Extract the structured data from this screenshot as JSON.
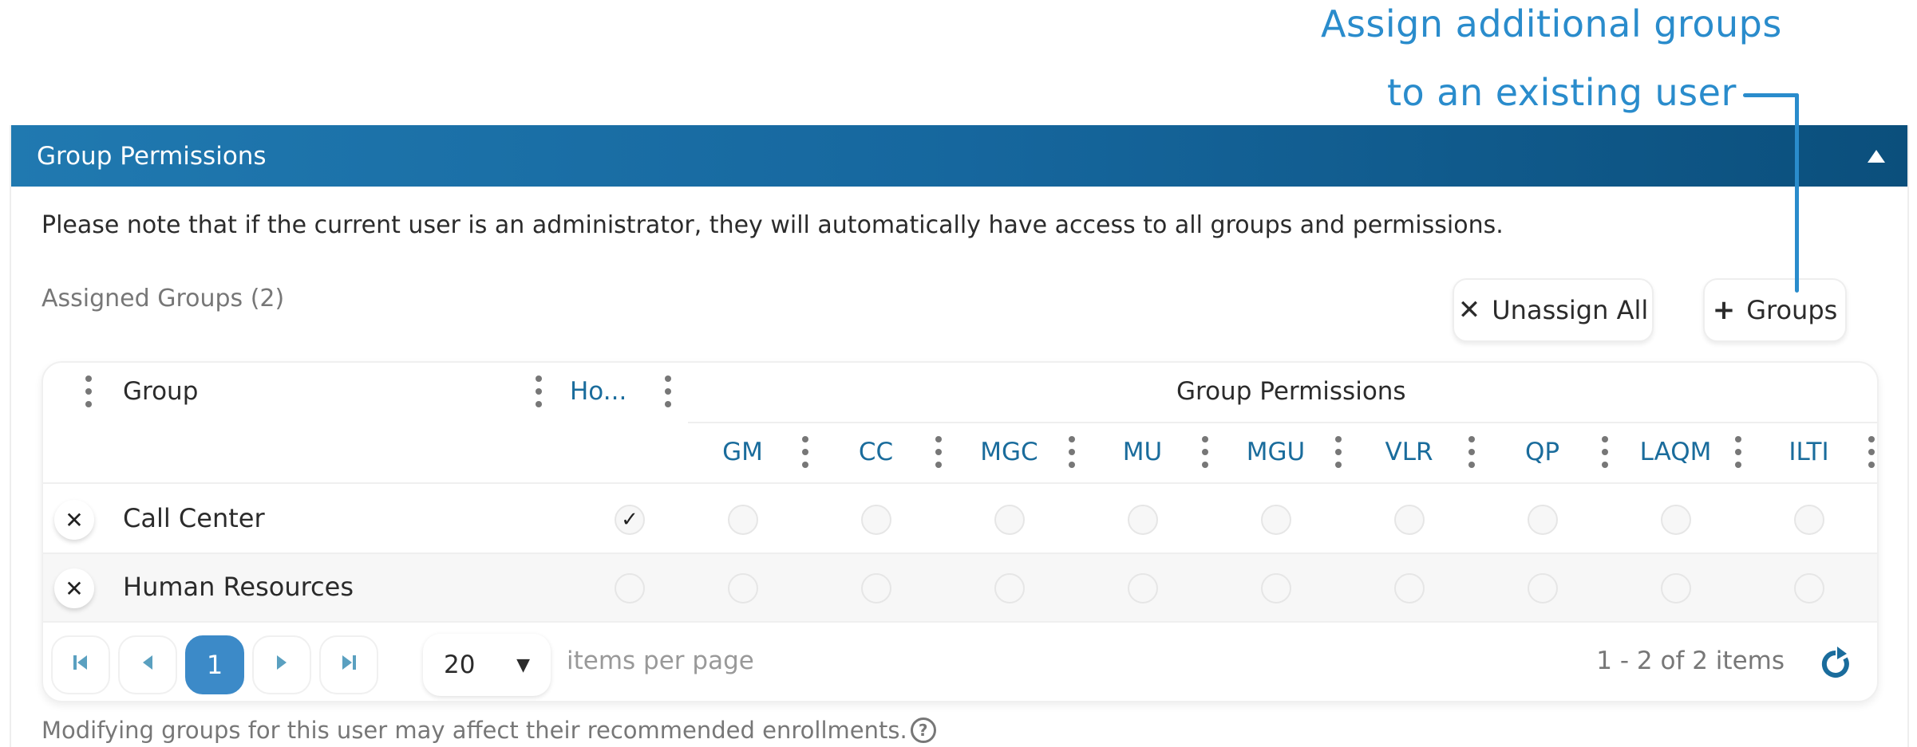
{
  "callout": {
    "line1": "Assign additional groups",
    "line2": "to an existing user",
    "color": "#2a8ccc"
  },
  "panel": {
    "title": "Group Permissions",
    "collapse_icon": "triangle-up-icon",
    "note": "Please note that if the current user is an administrator, they will automatically have access to all groups and permissions.",
    "assigned_label": "Assigned Groups (2)",
    "header_color": "#1a6ea4"
  },
  "toolbar": {
    "unassign_icon": "✕",
    "unassign_label": "Unassign All",
    "add_icon": "+",
    "add_label": "Groups"
  },
  "grid": {
    "columns": {
      "group": "Group",
      "home": "Ho...",
      "permissions_group": "Group Permissions",
      "permissions": [
        "GM",
        "CC",
        "MGC",
        "MU",
        "MGU",
        "VLR",
        "QP",
        "LAQM",
        "ILTI"
      ]
    },
    "rows": [
      {
        "name": "Call Center",
        "home": true,
        "permissions": [
          false,
          false,
          false,
          false,
          false,
          false,
          false,
          false,
          false
        ]
      },
      {
        "name": "Human Resources",
        "home": false,
        "permissions": [
          false,
          false,
          false,
          false,
          false,
          false,
          false,
          false,
          false
        ]
      }
    ],
    "remove_icon": "✕",
    "check_glyph": "✓"
  },
  "pager": {
    "first_icon": "⏮",
    "prev_icon": "◀",
    "current_page": "1",
    "next_icon": "▶",
    "last_icon": "⏭",
    "page_size": "20",
    "page_size_caret": "▼",
    "items_per_page_label": "items per page",
    "items_info": "1 - 2 of 2 items",
    "accent": "#3c8ac8"
  },
  "footnote": {
    "text": "Modifying groups for this user may affect their recommended enrollments.",
    "help_glyph": "?"
  }
}
